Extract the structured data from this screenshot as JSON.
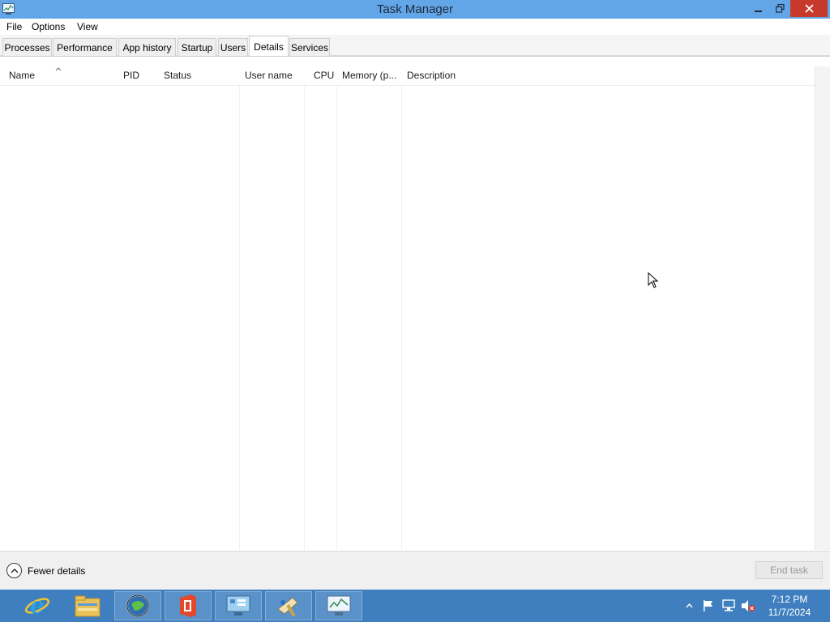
{
  "window": {
    "title": "Task Manager"
  },
  "menu": {
    "file": "File",
    "options": "Options",
    "view": "View"
  },
  "tabs": [
    {
      "label": "Processes",
      "active": false
    },
    {
      "label": "Performance",
      "active": false
    },
    {
      "label": "App history",
      "active": false
    },
    {
      "label": "Startup",
      "active": false
    },
    {
      "label": "Users",
      "active": false
    },
    {
      "label": "Details",
      "active": true
    },
    {
      "label": "Services",
      "active": false
    }
  ],
  "table": {
    "columns": [
      "Name",
      "PID",
      "Status",
      "User name",
      "CPU",
      "Memory (p...",
      "Description"
    ],
    "sorted_column": "Name",
    "rows": []
  },
  "footer": {
    "fewer_details": "Fewer details",
    "end_task": "End task",
    "end_task_enabled": false
  },
  "taskbar": {
    "apps": [
      "internet-explorer-icon",
      "file-explorer-icon",
      "browser-globe-icon",
      "office-icon",
      "control-panel-icon",
      "paint-icon",
      "task-manager-icon"
    ],
    "tray_icons": [
      "show-hidden-icons-icon",
      "flag-icon",
      "network-icon",
      "volume-muted-icon"
    ],
    "time": "7:12 PM",
    "date": "11/7/2024"
  },
  "colors": {
    "titlebar": "#63a6e8",
    "close_button": "#c7392a",
    "taskbar": "#3f7fbf"
  }
}
